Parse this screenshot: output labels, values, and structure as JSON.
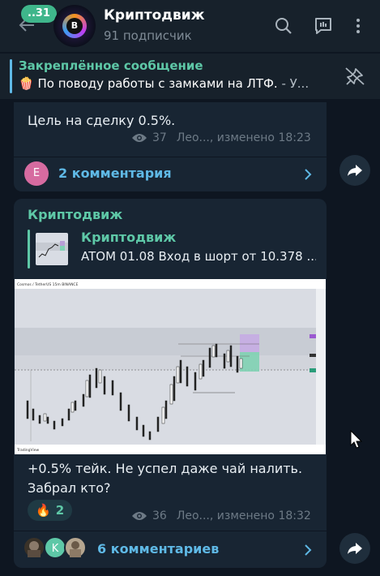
{
  "header": {
    "unread_count": "..31",
    "avatar_letter": "B",
    "title": "Криптодвиж",
    "subtitle": "91 подписчик",
    "icons": [
      "back-arrow-icon",
      "search-icon",
      "comments-icon",
      "more-vert-icon"
    ]
  },
  "pinned": {
    "title": "Закреплённое сообщение",
    "emoji": "🍿",
    "text": "По поводу работы с замками на ЛТФ.",
    "text_suffix": " - У..."
  },
  "messages": [
    {
      "text": "Цель на сделку 0.5%.",
      "views": "37",
      "author": "Лео..., изменено 18:23",
      "comments": {
        "avatar_letter": "E",
        "label": "2 комментария"
      }
    },
    {
      "sender": "Криптодвиж",
      "reply": {
        "name": "Криптодвиж",
        "text": "ATOM 01.08  Вход в шорт от 10.378 ..."
      },
      "chart_header": "Cosmos / TetherUS 15m BINANCE",
      "chart_footer": "TradingView",
      "text_line1": "+0.5% тейк. Не успел даже чай налить.",
      "text_line2": "Забрал кто?",
      "reaction": {
        "emoji": "🔥",
        "count": "2"
      },
      "views": "36",
      "author": "Лео..., изменено 18:32",
      "comments": {
        "avatar_letter": "K",
        "label": "6 комментариев"
      }
    }
  ],
  "colors": {
    "background": "#0e1621",
    "bubble": "#182533",
    "accent_green": "#5ec8a7",
    "accent_blue": "#5fb9e6"
  }
}
